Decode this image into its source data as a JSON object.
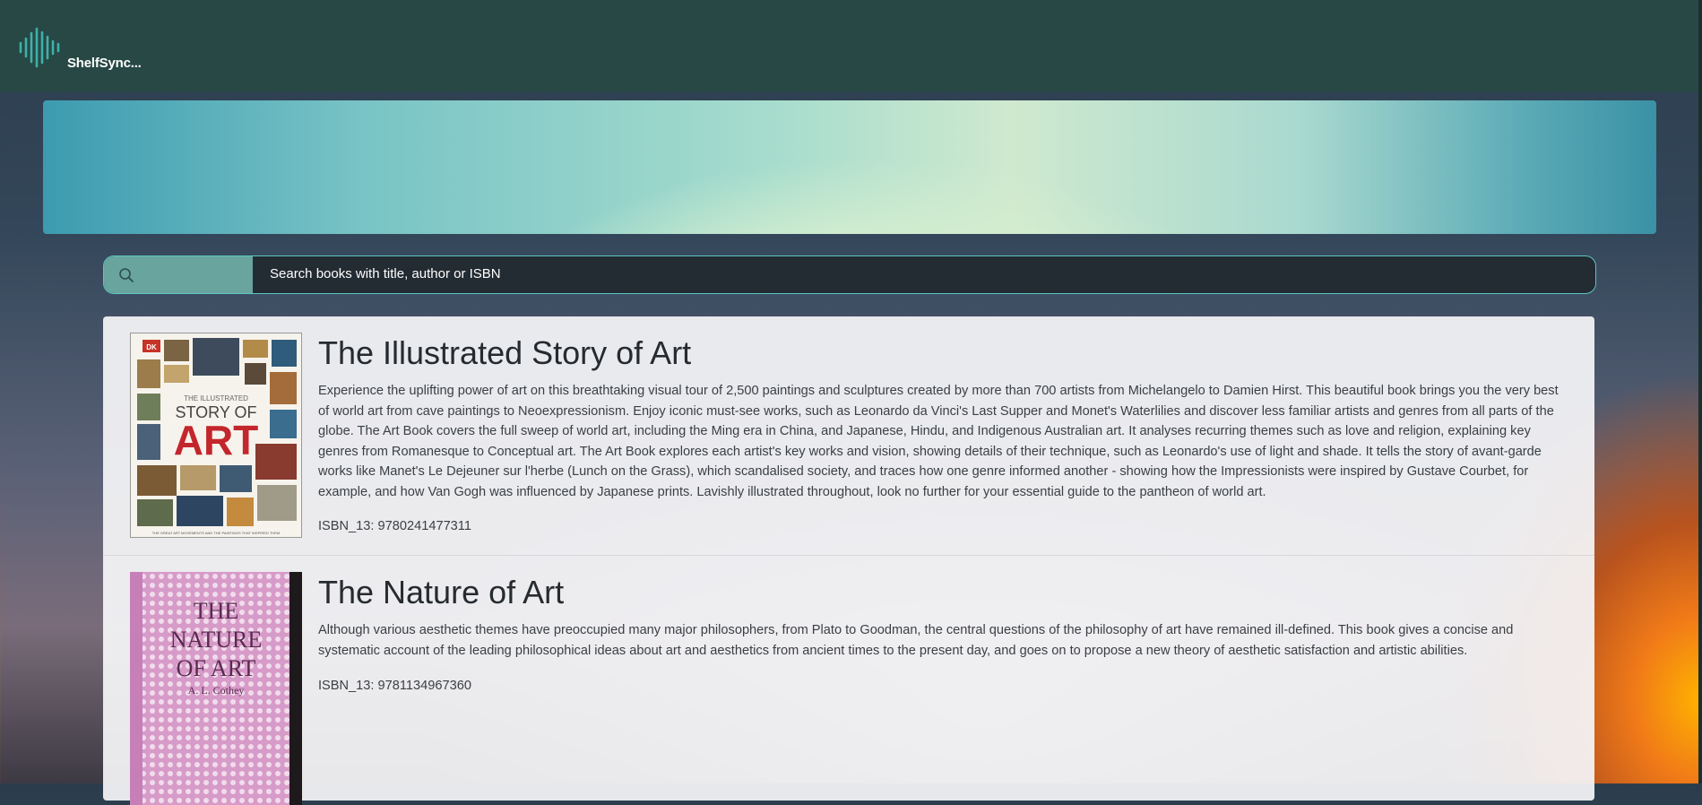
{
  "app": {
    "name": "ShelfSync..."
  },
  "search": {
    "placeholder": "Search books with title, author or ISBN"
  },
  "results": [
    {
      "title": "The Illustrated Story of Art",
      "description": "Experience the uplifting power of art on this breathtaking visual tour of 2,500 paintings and sculptures created by more than 700 artists from Michelangelo to Damien Hirst. This beautiful book brings you the very best of world art from cave paintings to Neoexpressionism. Enjoy iconic must-see works, such as Leonardo da Vinci's Last Supper and Monet's Waterlilies and discover less familiar artists and genres from all parts of the globe. The Art Book covers the full sweep of world art, including the Ming era in China, and Japanese, Hindu, and Indigenous Australian art. It analyses recurring themes such as love and religion, explaining key genres from Romanesque to Conceptual art. The Art Book explores each artist's key works and vision, showing details of their technique, such as Leonardo's use of light and shade. It tells the story of avant-garde works like Manet's Le Dejeuner sur l'herbe (Lunch on the Grass), which scandalised society, and traces how one genre informed another - showing how the Impressionists were inspired by Gustave Courbet, for example, and how Van Gogh was influenced by Japanese prints. Lavishly illustrated throughout, look no further for your essential guide to the pantheon of world art.",
      "isbn": "ISBN_13: 9780241477311",
      "cover": {
        "top_line": "THE ILLUSTRATED",
        "line1": "STORY OF",
        "line2": "ART",
        "publisher": "DK",
        "tagline": "THE GREAT ART MOVEMENTS AND THE PAINTINGS THAT INSPIRED THEM"
      }
    },
    {
      "title": "The Nature of Art",
      "description": "Although various aesthetic themes have preoccupied many major philosophers, from Plato to Goodman, the central questions of the philosophy of art have remained ill-defined. This book gives a concise and systematic account of the leading philosophical ideas about art and aesthetics from ancient times to the present day, and goes on to propose a new theory of aesthetic satisfaction and artistic abilities.",
      "isbn": "ISBN_13: 9781134967360",
      "cover": {
        "line1": "THE",
        "line2": "NATURE",
        "line3": "OF ART",
        "author": "A. L. Cothey"
      }
    }
  ],
  "colors": {
    "navbar": "#274845",
    "accent": "#5bc6c4",
    "search_icon_bg": "#69a49e",
    "cover2_pink": "#d79bc9"
  },
  "icons": {
    "logo": "sound-wave-icon",
    "search": "search-icon"
  }
}
